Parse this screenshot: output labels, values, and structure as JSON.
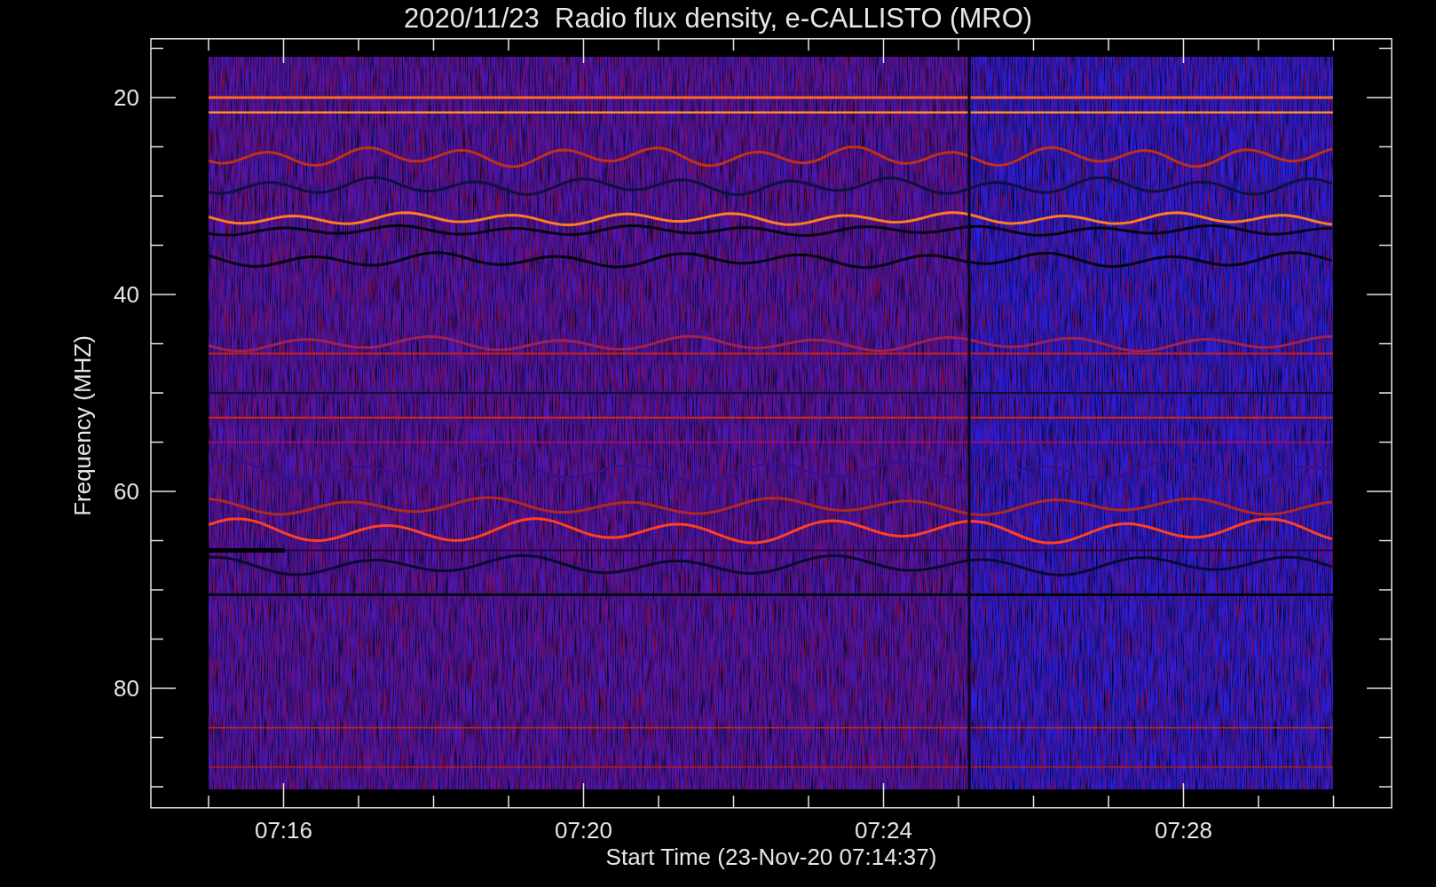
{
  "title": "2020/11/23  Radio flux density, e-CALLISTO (MRO)",
  "y_axis": {
    "label": "Frequency (MHZ)",
    "ticks": [
      "20",
      "40",
      "60",
      "80"
    ]
  },
  "x_axis": {
    "label": "Start Time (23-Nov-20 07:14:37)",
    "ticks": [
      "07:16",
      "07:20",
      "07:24",
      "07:28"
    ]
  }
}
